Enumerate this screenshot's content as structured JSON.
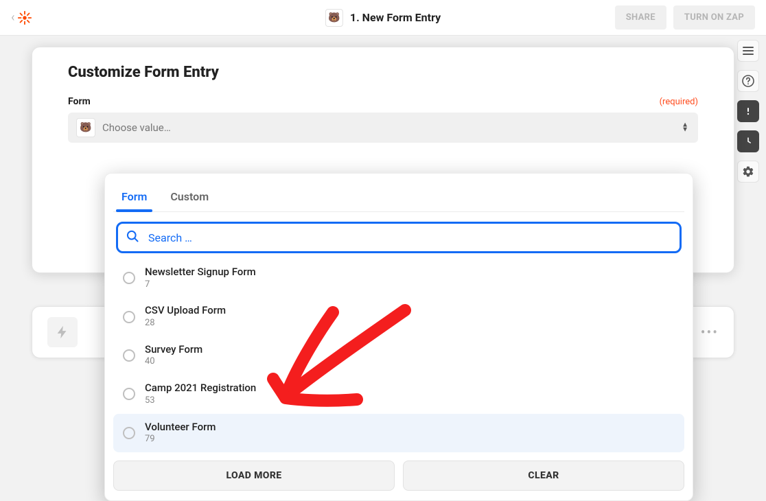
{
  "header": {
    "title": "1. New Form Entry",
    "share_label": "SHARE",
    "turnon_label": "TURN ON ZAP"
  },
  "card": {
    "heading": "Customize Form Entry",
    "field_label": "Form",
    "required_label": "(required)",
    "placeholder": "Choose value…"
  },
  "popover": {
    "tabs": {
      "form": "Form",
      "custom": "Custom"
    },
    "search_placeholder": "Search …",
    "options": [
      {
        "label": "Newsletter Signup Form",
        "id": "7"
      },
      {
        "label": "CSV Upload Form",
        "id": "28"
      },
      {
        "label": "Survey Form",
        "id": "40"
      },
      {
        "label": "Camp 2021 Registration",
        "id": "53"
      },
      {
        "label": "Volunteer Form",
        "id": "79"
      }
    ],
    "load_more": "LOAD MORE",
    "clear": "CLEAR",
    "highlight_index": 4
  },
  "rail": {
    "icons": [
      "menu-icon",
      "help-icon",
      "alert-icon",
      "history-icon",
      "settings-icon"
    ]
  }
}
